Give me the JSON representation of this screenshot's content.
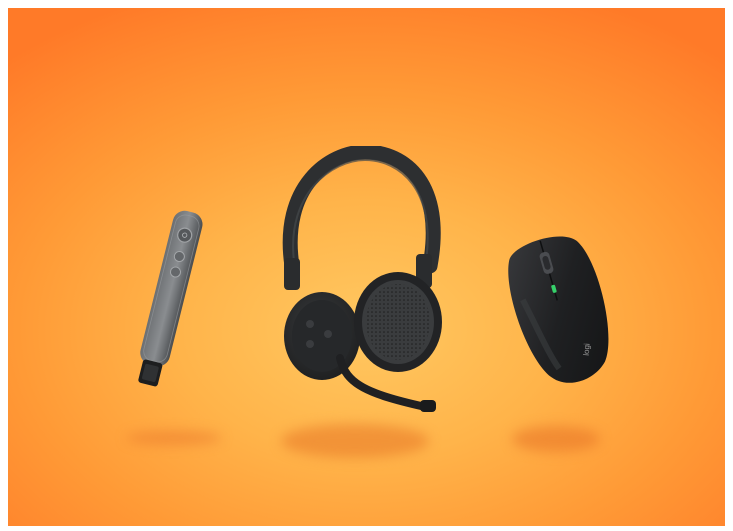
{
  "scene": {
    "background": {
      "inner": "#ffc861",
      "mid": "#ffa640",
      "outer": "#ff7a28"
    },
    "products": [
      {
        "name": "presenter-remote",
        "color": "#5b5e61"
      },
      {
        "name": "wireless-headset",
        "color": "#2b2d2f"
      },
      {
        "name": "wireless-mouse",
        "color": "#1f2022"
      }
    ],
    "mouse_logo": "logi"
  }
}
